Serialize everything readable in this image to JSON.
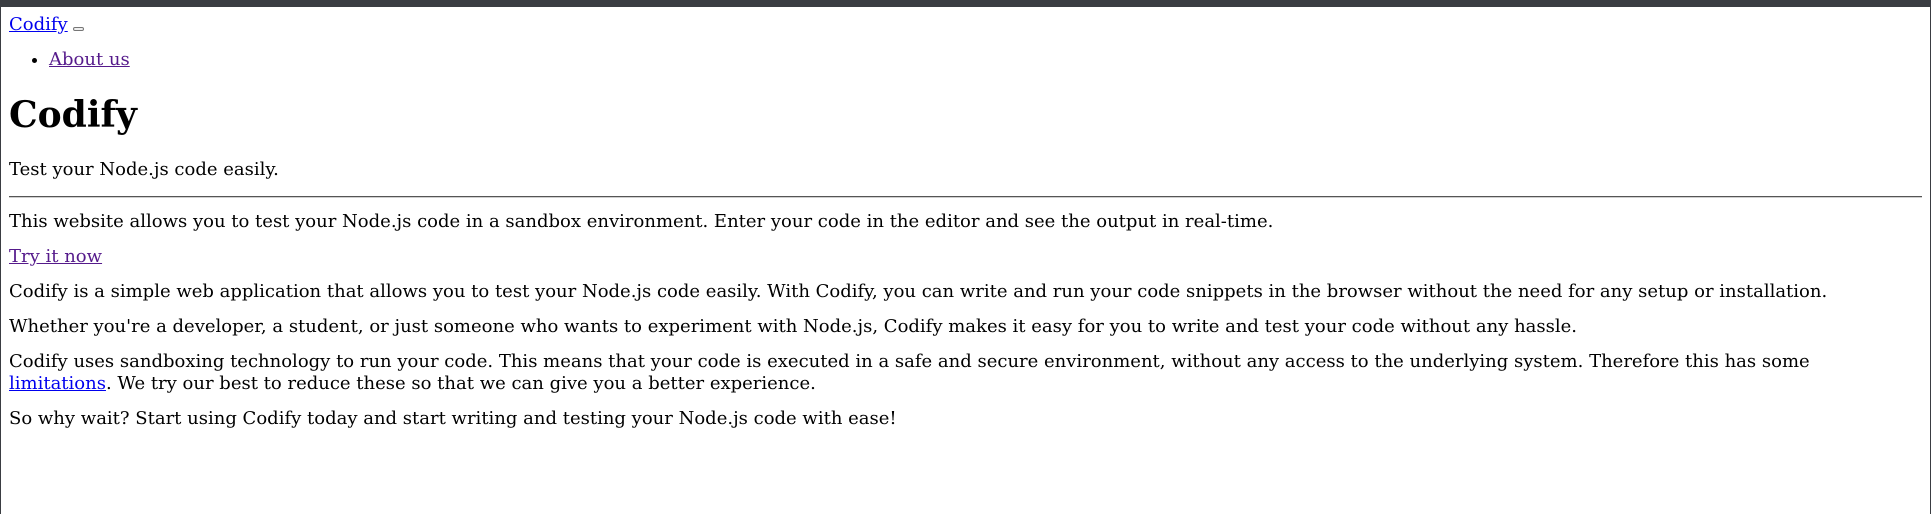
{
  "navbar": {
    "brand": "Codify",
    "links": [
      {
        "label": "About us"
      }
    ]
  },
  "hero": {
    "title": "Codify",
    "subtitle": "Test your Node.js code easily.",
    "description": "This website allows you to test your Node.js code in a sandbox environment. Enter your code in the editor and see the output in real-time.",
    "cta_label": "Try it now"
  },
  "about": {
    "p1": "Codify is a simple web application that allows you to test your Node.js code easily. With Codify, you can write and run your code snippets in the browser without the need for any setup or installation.",
    "p2": "Whether you're a developer, a student, or just someone who wants to experiment with Node.js, Codify makes it easy for you to write and test your code without any hassle.",
    "p3_before": "Codify uses sandboxing technology to run your code. This means that your code is executed in a safe and secure environment, without any access to the underlying system. Therefore this has some ",
    "p3_link": "limitations",
    "p3_after": ". We try our best to reduce these so that we can give you a better experience.",
    "p4": "So why wait? Start using Codify today and start writing and testing your Node.js code with ease!"
  },
  "colors": {
    "link": "#0000ee",
    "visited_link": "#551a8b",
    "frame_border": "#3a3d42"
  }
}
